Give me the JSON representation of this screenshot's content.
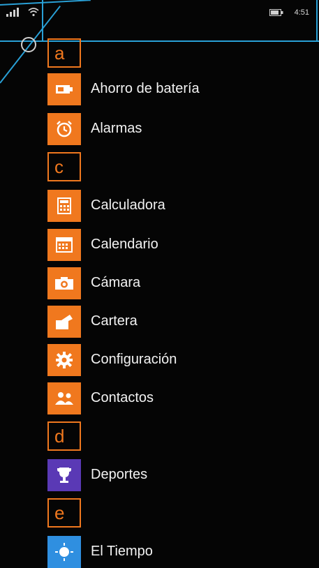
{
  "status_bar": {
    "time": "4:51",
    "icons": [
      "signal-bars-icon",
      "wifi-icon",
      "battery-icon"
    ]
  },
  "accent_color": "#f0781e",
  "annotation_color": "#29a0d6",
  "search": {
    "icon": "search-icon"
  },
  "apps": {
    "groups": [
      {
        "letter": "a",
        "items": [
          {
            "label": "Ahorro de batería",
            "icon": "battery-saver-icon"
          },
          {
            "label": "Alarmas",
            "icon": "alarm-clock-icon"
          }
        ]
      },
      {
        "letter": "c",
        "items": [
          {
            "label": "Calculadora",
            "icon": "calculator-icon"
          },
          {
            "label": "Calendario",
            "icon": "calendar-icon"
          },
          {
            "label": "Cámara",
            "icon": "camera-icon"
          },
          {
            "label": "Cartera",
            "icon": "wallet-icon"
          },
          {
            "label": "Configuración",
            "icon": "gear-icon"
          },
          {
            "label": "Contactos",
            "icon": "contacts-icon"
          }
        ]
      },
      {
        "letter": "d",
        "items": [
          {
            "label": "Deportes",
            "icon": "trophy-icon",
            "tile_color": "#5a39b5"
          }
        ]
      },
      {
        "letter": "e",
        "items": [
          {
            "label": "El Tiempo",
            "icon": "sun-icon",
            "tile_color": "#2f8fe0"
          }
        ]
      }
    ]
  }
}
